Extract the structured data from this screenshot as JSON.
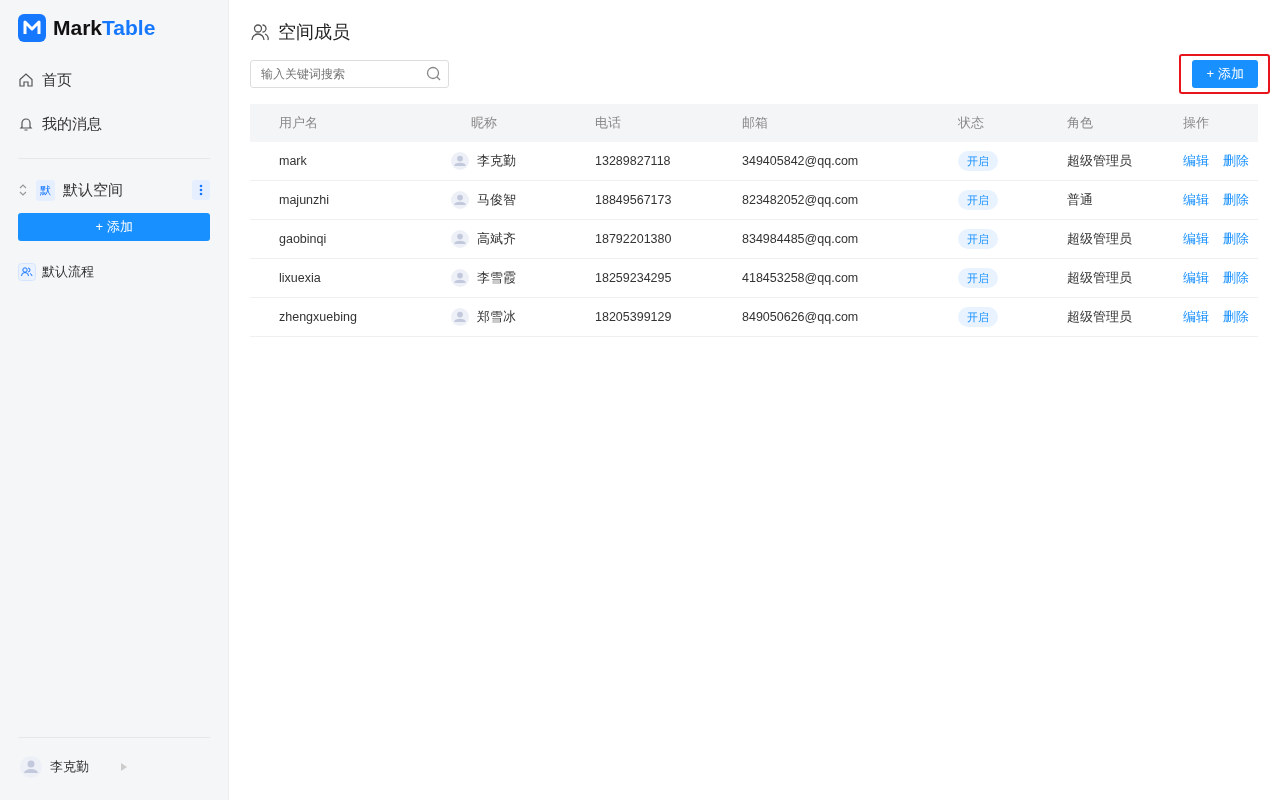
{
  "logo": {
    "part_1": "Mark",
    "part_2": "Table"
  },
  "nav": [
    {
      "kind": "home",
      "label": "首页"
    },
    {
      "kind": "bell",
      "label": "我的消息"
    }
  ],
  "space": {
    "badge": "默",
    "name": "默认空间",
    "add_button": "+ 添加"
  },
  "workflows": [
    {
      "label": "默认流程"
    }
  ],
  "user": {
    "name": "李克勤"
  },
  "page": {
    "title": "空间成员",
    "search": {
      "placeholder": "输入关键词搜索"
    },
    "add_button": {
      "label": "+ 添加",
      "highlighted": true
    }
  },
  "table": {
    "columns": [
      "用户名",
      "昵称",
      "电话",
      "邮箱",
      "状态",
      "角色",
      "操作"
    ],
    "rows": [
      {
        "username": "mark",
        "nickname": "李克勤",
        "phone": "13289827118",
        "email": "349405842@qq.com",
        "status": "开启",
        "role": "超级管理员",
        "actions": [
          "编辑",
          "删除"
        ]
      },
      {
        "username": "majunzhi",
        "nickname": "马俊智",
        "phone": "18849567173",
        "email": "823482052@qq.com",
        "status": "开启",
        "role": "普通",
        "actions": [
          "编辑",
          "删除"
        ]
      },
      {
        "username": "gaobinqi",
        "nickname": "高斌齐",
        "phone": "18792201380",
        "email": "834984485@qq.com",
        "status": "开启",
        "role": "超级管理员",
        "actions": [
          "编辑",
          "删除"
        ]
      },
      {
        "username": "lixuexia",
        "nickname": "李雪霞",
        "phone": "18259234295",
        "email": "418453258@qq.com",
        "status": "开启",
        "role": "超级管理员",
        "actions": [
          "编辑",
          "删除"
        ]
      },
      {
        "username": "zhengxuebing",
        "nickname": "郑雪冰",
        "phone": "18205399129",
        "email": "849050626@qq.com",
        "status": "开启",
        "role": "超级管理员",
        "actions": [
          "编辑",
          "删除"
        ]
      }
    ]
  }
}
